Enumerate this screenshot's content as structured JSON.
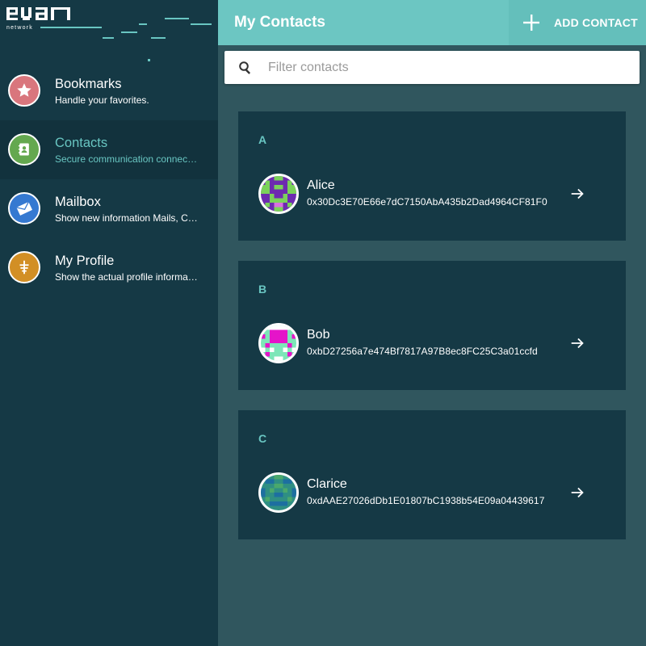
{
  "logo": {
    "wordmark": "evan",
    "tagline": "network"
  },
  "sidebar": {
    "items": [
      {
        "title": "Bookmarks",
        "subtitle": "Handle your favorites.",
        "icon": "star-icon",
        "color": "#d9767d",
        "active": false
      },
      {
        "title": "Contacts",
        "subtitle": "Secure communication connections",
        "icon": "address-book-icon",
        "color": "#64a84f",
        "active": true
      },
      {
        "title": "Mailbox",
        "subtitle": "Show new information Mails, Contact requests and more",
        "icon": "mail-icon",
        "color": "#3579d1",
        "active": false
      },
      {
        "title": "My Profile",
        "subtitle": "Show the actual profile information",
        "icon": "profile-icon",
        "color": "#d28f25",
        "active": false
      }
    ]
  },
  "header": {
    "title": "My Contacts",
    "add_label": "ADD CONTACT"
  },
  "search": {
    "placeholder": "Filter contacts",
    "value": ""
  },
  "groups": [
    {
      "letter": "A",
      "contacts": [
        {
          "name": "Alice",
          "address": "0x30Dc3E70E66e7dC7150AbA435b2Dad4964CF81F0"
        }
      ]
    },
    {
      "letter": "B",
      "contacts": [
        {
          "name": "Bob",
          "address": "0xbD27256a7e474Bf7817A97B8ec8FC25C3a01ccfd"
        }
      ]
    },
    {
      "letter": "C",
      "contacts": [
        {
          "name": "Clarice",
          "address": "0xdAAE27026dDb1E01807bC1938b54E09a04439617"
        }
      ]
    }
  ],
  "colors": {
    "accent": "#6cc6c2",
    "sidebar_bg": "#153945",
    "content_bg": "#30565e",
    "card_bg": "#153945"
  }
}
